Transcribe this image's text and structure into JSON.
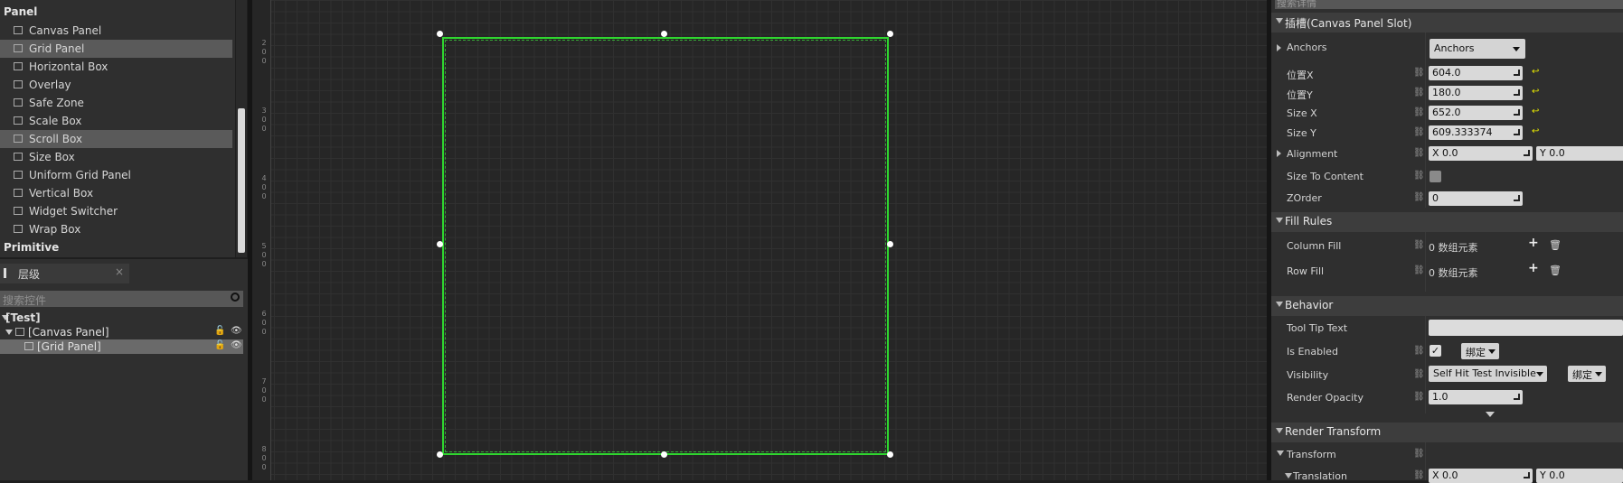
{
  "palette": {
    "section_panel": "Panel",
    "section_primitive": "Primitive",
    "items": [
      {
        "label": "Canvas Panel",
        "selected": false
      },
      {
        "label": "Grid Panel",
        "selected": true
      },
      {
        "label": "Horizontal Box",
        "selected": false
      },
      {
        "label": "Overlay",
        "selected": false
      },
      {
        "label": "Safe Zone",
        "selected": false
      },
      {
        "label": "Scale Box",
        "selected": false
      },
      {
        "label": "Scroll Box",
        "selected": true
      },
      {
        "label": "Size Box",
        "selected": false
      },
      {
        "label": "Uniform Grid Panel",
        "selected": false
      },
      {
        "label": "Vertical Box",
        "selected": false
      },
      {
        "label": "Widget Switcher",
        "selected": false
      },
      {
        "label": "Wrap Box",
        "selected": false
      }
    ]
  },
  "hierarchy": {
    "tab_label": "层级",
    "close": "×",
    "search_placeholder": "搜索控件",
    "root": "[Test]",
    "nodes": [
      "[Canvas Panel]",
      "[Grid Panel]"
    ]
  },
  "ruler": {
    "labels": [
      "2\n0\n0",
      "3\n0\n0",
      "4\n0\n0",
      "5\n0\n0",
      "6\n0\n0",
      "7\n0\n0",
      "8\n0\n0"
    ]
  },
  "details": {
    "search_placeholder": "搜索详情",
    "slot_title": "插槽(Canvas Panel Slot)",
    "anchors_label": "Anchors",
    "anchors_value": "Anchors",
    "pos_x_label": "位置X",
    "pos_x": "604.0",
    "pos_y_label": "位置Y",
    "pos_y": "180.0",
    "size_x_label": "Size X",
    "size_x": "652.0",
    "size_y_label": "Size Y",
    "size_y": "609.333374",
    "alignment_label": "Alignment",
    "align_x": "X  0.0",
    "align_y": "Y  0.0",
    "size_to_content_label": "Size To Content",
    "zorder_label": "ZOrder",
    "zorder": "0",
    "fill_rules_title": "Fill Rules",
    "column_fill_label": "Column Fill",
    "column_fill": "0 数组元素",
    "row_fill_label": "Row Fill",
    "row_fill": "0 数组元素",
    "behavior_title": "Behavior",
    "tooltip_label": "Tool Tip Text",
    "tooltip_value": "",
    "is_enabled_label": "Is Enabled",
    "bind_label": "绑定",
    "visibility_label": "Visibility",
    "visibility_value": "Self Hit Test Invisible",
    "render_opacity_label": "Render Opacity",
    "render_opacity": "1.0",
    "render_transform_title": "Render Transform",
    "transform_label": "Transform",
    "translation_label": "Translation",
    "trans_x": "X  0.0",
    "trans_y": "Y  0.0"
  },
  "colors": {
    "selection_outline": "#2fd52f",
    "reset_arrow": "#e8e800"
  }
}
